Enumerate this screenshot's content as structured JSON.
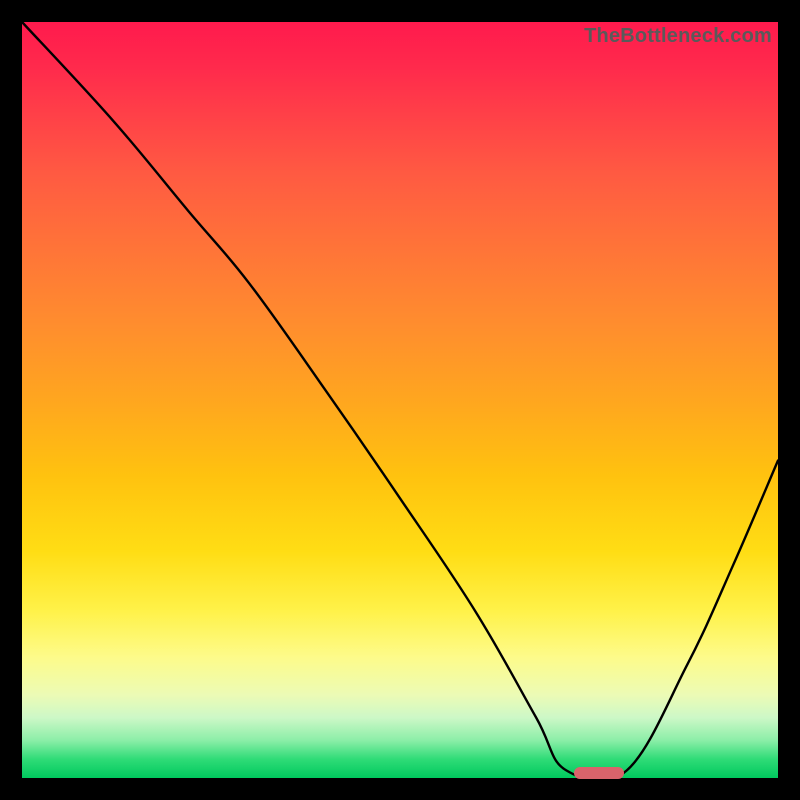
{
  "watermark": "TheBottleneck.com",
  "colors": {
    "page_bg": "#000000",
    "marker": "#d9636b",
    "curve": "#000000"
  },
  "marker": {
    "x_pct": 73.0,
    "width_pct": 6.6,
    "y_pct": 99.3
  },
  "chart_data": {
    "type": "line",
    "title": "",
    "xlabel": "",
    "ylabel": "",
    "xlim": [
      0,
      100
    ],
    "ylim": [
      0,
      100
    ],
    "grid": false,
    "legend": null,
    "annotations": [
      "TheBottleneck.com"
    ],
    "gradient_background": "red-yellow-green (top→bottom)",
    "series": [
      {
        "name": "bottleneck-curve",
        "x": [
          0.0,
          12.0,
          22.0,
          30.0,
          40.0,
          50.0,
          60.0,
          68.0,
          72.0,
          80.0,
          88.0,
          94.0,
          100.0
        ],
        "y": [
          100.0,
          87.0,
          75.0,
          65.5,
          51.5,
          37.0,
          22.0,
          8.0,
          1.0,
          1.0,
          15.0,
          28.0,
          42.0
        ],
        "note": "Piecewise curve: steep linear drop from top-left, leveling near x≈72–80 at bottom (minimum), then rising again toward right edge."
      }
    ],
    "optimum_marker": {
      "x_center_pct": 76.3,
      "x_start_pct": 73.0,
      "x_end_pct": 79.6,
      "y_pct": 0.7,
      "shape": "rounded-rect",
      "color": "#d9636b"
    }
  }
}
